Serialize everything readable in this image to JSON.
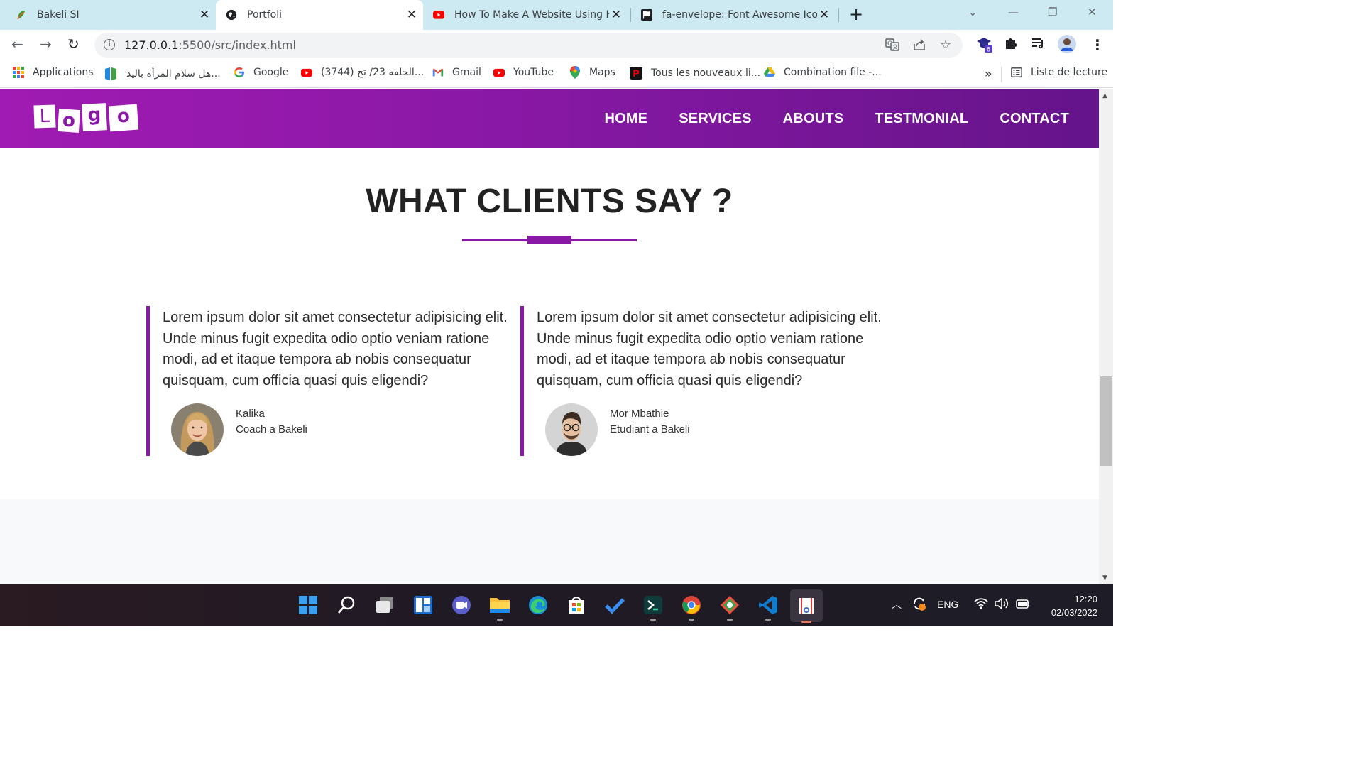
{
  "browser": {
    "tabs": [
      {
        "title": "Bakeli SI",
        "icon": "bakeli-leaf-icon"
      },
      {
        "title": "Portfoli",
        "icon": "globe-icon",
        "active": true
      },
      {
        "title": "How To Make A Website Using H",
        "icon": "youtube-icon"
      },
      {
        "title": "fa-envelope: Font Awesome Icon",
        "icon": "font-awesome-flag-icon"
      }
    ],
    "url_host": "127.0.0.1",
    "url_rest": ":5500/src/index.html",
    "extension_badge": "6"
  },
  "bookmarks": {
    "items": [
      {
        "label": "Applications",
        "icon": "apps-grid-icon"
      },
      {
        "label": "هل سلام المرأة باليد...",
        "icon": "bookmark-green-icon"
      },
      {
        "label": "Google",
        "icon": "google-icon"
      },
      {
        "label": "(3744) الحلقه 23/ تج...",
        "icon": "youtube-icon"
      },
      {
        "label": "Gmail",
        "icon": "gmail-icon"
      },
      {
        "label": "YouTube",
        "icon": "youtube-icon"
      },
      {
        "label": "Maps",
        "icon": "maps-pin-icon"
      },
      {
        "label": "Tous les nouveaux li...",
        "icon": "p-red-icon"
      },
      {
        "label": "Combination file -...",
        "icon": "drive-icon"
      }
    ],
    "overflow": "»",
    "reading_list": "Liste de lecture"
  },
  "site": {
    "logo_letters": [
      "L",
      "o",
      "g",
      "o"
    ],
    "menu": [
      "HOME",
      "SERVICES",
      "ABOUTS",
      "TESTMONIAL",
      "CONTACT"
    ],
    "heading": "WHAT CLIENTS SAY ?",
    "testimonials": [
      {
        "quote": "Lorem ipsum dolor sit amet consectetur adipisicing elit. Unde minus fugit expedita odio optio veniam ratione modi, ad et itaque tempora ab nobis consequatur quisquam, cum officia quasi quis eligendi?",
        "name": "Kalika",
        "role": "Coach a Bakeli"
      },
      {
        "quote": "Lorem ipsum dolor sit amet consectetur adipisicing elit. Unde minus fugit expedita odio optio veniam ratione modi, ad et itaque tempora ab nobis consequatur quisquam, cum officia quasi quis eligendi?",
        "name": "Mor Mbathie",
        "role": "Etudiant a Bakeli"
      }
    ],
    "accent_color": "#8a18a6"
  },
  "taskbar": {
    "language": "ENG",
    "time": "12:20",
    "date": "02/03/2022"
  }
}
